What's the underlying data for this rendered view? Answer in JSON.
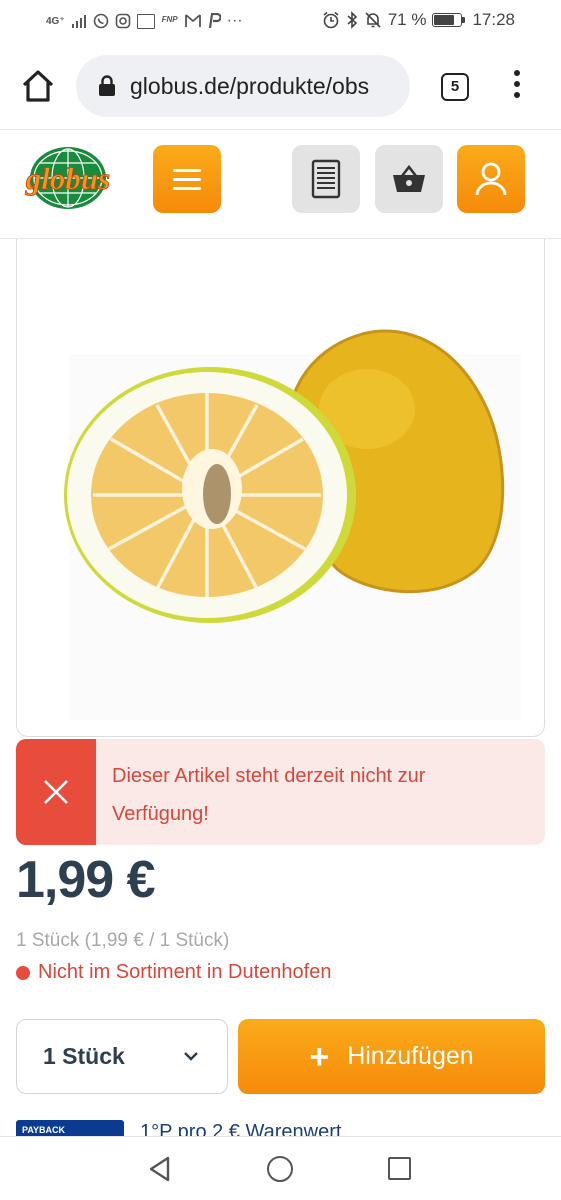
{
  "status_bar": {
    "network": "4G⁺",
    "battery_percent": "71 %",
    "battery_level": 0.71,
    "time": "17:28",
    "left_icons": [
      "signal-icon",
      "whatsapp-icon",
      "instagram-icon",
      "news-icon",
      "app-icon",
      "gmail-icon",
      "paypal-icon",
      "more-icon"
    ],
    "right_icons": [
      "alarm-icon",
      "bluetooth-icon",
      "mute-icon",
      "battery-icon"
    ],
    "more": "···"
  },
  "browser": {
    "url": "globus.de/produkte/obs",
    "tab_count": "5"
  },
  "header": {
    "logo_text": "globus",
    "icons": [
      "menu-icon",
      "shopping-list-icon",
      "basket-icon",
      "user-icon"
    ],
    "accent_color": "#f7941d"
  },
  "alert": {
    "message_line1": "Dieser Artikel steht derzeit nicht zur",
    "message_line2": "Verfügung!",
    "color": "#e84c3d"
  },
  "product": {
    "price": "1,99 €",
    "unit_price": "1 Stück (1,99 € / 1 Stück)",
    "availability": "Nicht im Sortiment in Dutenhofen"
  },
  "purchase": {
    "quantity": "1 Stück",
    "add_plus": "+",
    "add_label": "Hinzufügen"
  },
  "payback": {
    "logo_text": "PAYBACK",
    "text": "1°P pro 2 € Warenwert"
  },
  "nav": {
    "icons": [
      "back-icon",
      "home-icon",
      "recent-apps-icon"
    ]
  }
}
